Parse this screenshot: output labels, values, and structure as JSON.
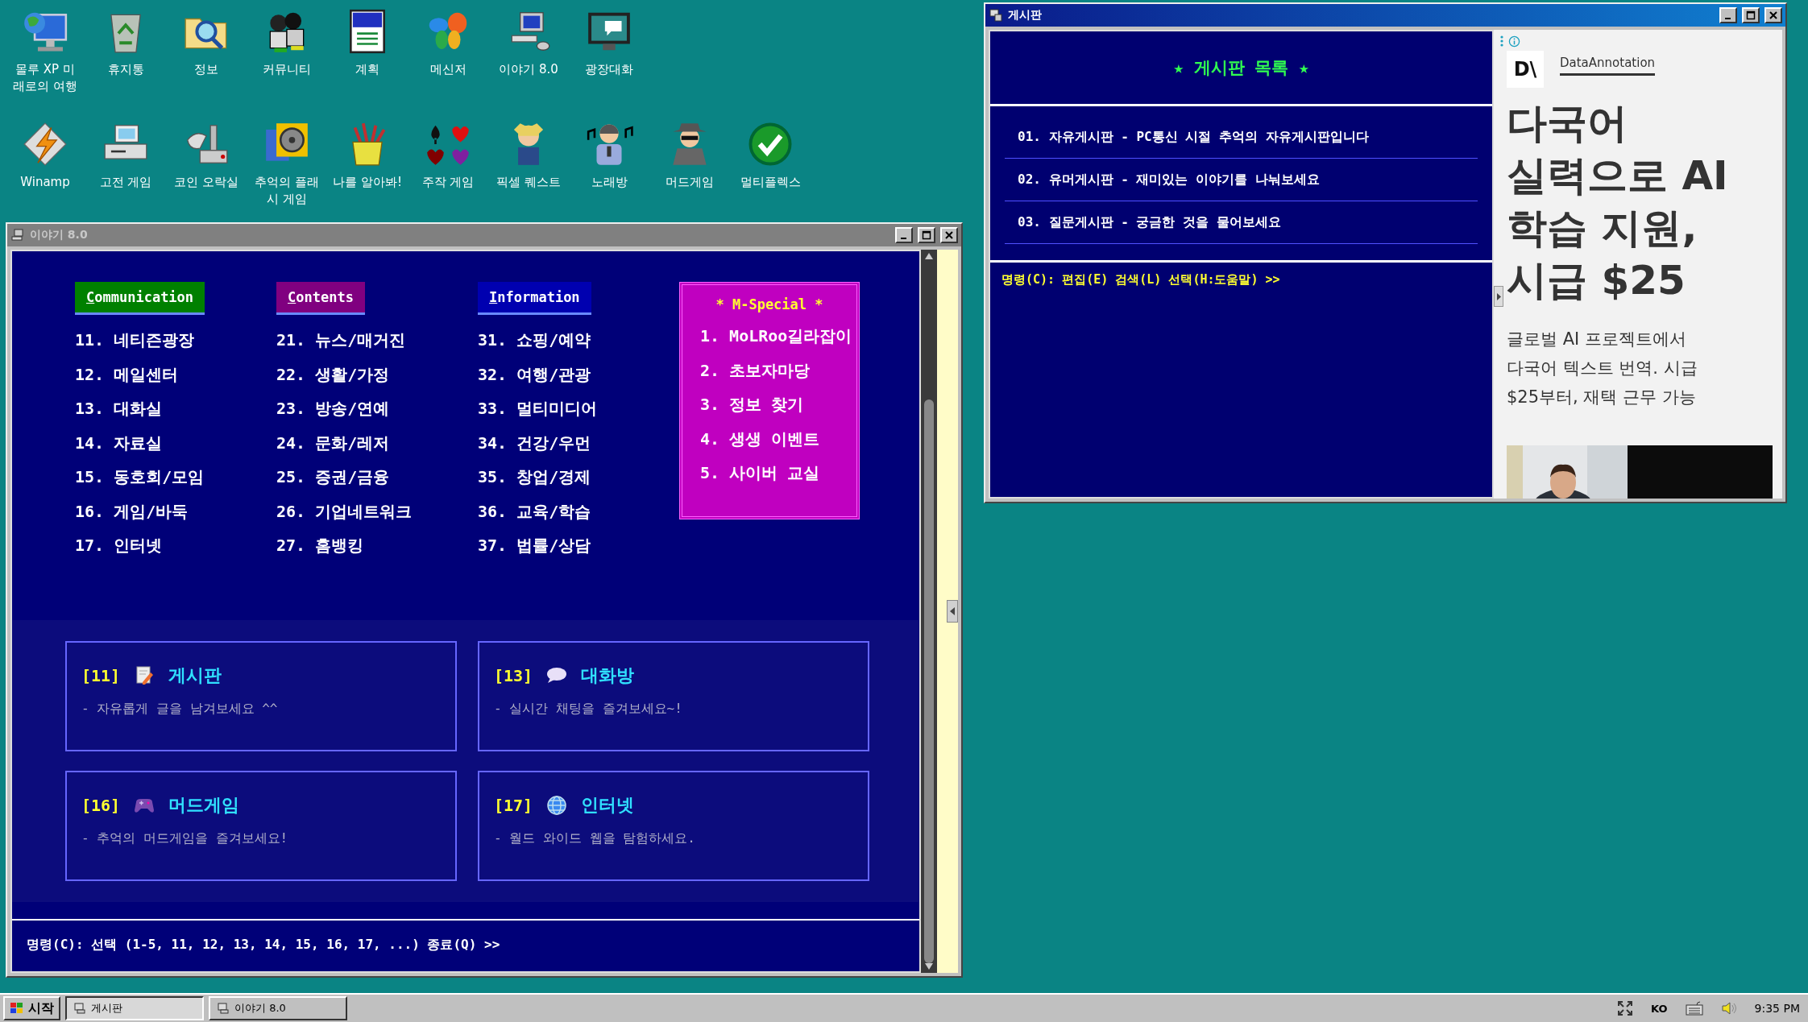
{
  "desktop_rows": [
    {
      "icons": [
        {
          "label": "몰루 XP 미래로의 여행"
        },
        {
          "label": "휴지통"
        },
        {
          "label": "정보"
        },
        {
          "label": "커뮤니티"
        },
        {
          "label": "계획"
        },
        {
          "label": "메신저"
        },
        {
          "label": "이야기 8.0"
        },
        {
          "label": "광장대화"
        }
      ]
    },
    {
      "icons": [
        {
          "label": "Winamp"
        },
        {
          "label": "고전 게임"
        },
        {
          "label": "코인 오락실"
        },
        {
          "label": "추억의 플래시 게임"
        },
        {
          "label": "나를 알아봐!"
        },
        {
          "label": "주작 게임"
        },
        {
          "label": "픽셀 퀘스트"
        },
        {
          "label": "노래방"
        },
        {
          "label": "머드게임"
        },
        {
          "label": "멀티플렉스"
        }
      ]
    }
  ],
  "main_window": {
    "title": "이야기 8.0",
    "active": false,
    "menu_columns": [
      {
        "heading": "Communication",
        "color": "#008000",
        "items": [
          "11. 네티즌광장",
          "12. 메일센터",
          "13. 대화실",
          "14. 자료실",
          "15. 동호회/모임",
          "16. 게임/바둑",
          "17. 인터넷"
        ]
      },
      {
        "heading": "Contents",
        "color": "#800080",
        "items": [
          "21. 뉴스/매거진",
          "22. 생활/가정",
          "23. 방송/연예",
          "24. 문화/레저",
          "25. 증권/금융",
          "26. 기업네트워크",
          "27. 홈뱅킹"
        ]
      },
      {
        "heading": "Information",
        "color": "#0000b0",
        "items": [
          "31. 쇼핑/예약",
          "32. 여행/관광",
          "33. 멀티미디어",
          "34. 건강/우먼",
          "35. 창업/경제",
          "36. 교육/학습",
          "37. 법률/상담"
        ]
      }
    ],
    "special": {
      "title": "* M-Special *",
      "items": [
        "1. MoLRoo길라잡이",
        "2. 초보자마당",
        "3. 정보 찾기",
        "4. 생생 이벤트",
        "5. 사이버 교실"
      ]
    },
    "cards": [
      {
        "code": "[11]",
        "title": "게시판",
        "desc": "- 자유롭게 글을 남겨보세요 ^^"
      },
      {
        "code": "[13]",
        "title": "대화방",
        "desc": "- 실시간 채팅을 즐겨보세요~!"
      },
      {
        "code": "[16]",
        "title": "머드게임",
        "desc": "- 추억의 머드게임을 즐겨보세요!"
      },
      {
        "code": "[17]",
        "title": "인터넷",
        "desc": "- 월드 와이드 웹을 탐험하세요."
      }
    ],
    "command": "명령(C): 선택 (1-5, 11, 12, 13, 14, 15, 16, 17, ...) 종료(Q) >>"
  },
  "board_window": {
    "title": "게시판",
    "active": true,
    "heading": "★ 게시판 목록 ★",
    "posts": [
      "01. 자유게시판 - PC통신 시절 추억의 자유게시판입니다",
      "02. 유머게시판 - 재미있는 이야기를 나눠보세요",
      "03. 질문게시판 - 궁금한 것을 물어보세요"
    ],
    "command": "명령(C): 편집(E) 검색(L) 선택(H:도움말) >>",
    "ad": {
      "logo": "D\\",
      "brand": "DataAnnotation",
      "headline": "다국어 실력으로 AI 학습 지원, 시급 $25",
      "body": "글로벌 AI 프로젝트에서 다국어 텍스트 번역. 시급 $25부터, 재택 근무 가능"
    }
  },
  "taskbar": {
    "start": "시작",
    "tasks": [
      {
        "label": "게시판",
        "selected": true
      },
      {
        "label": "이야기 8.0",
        "selected": false
      }
    ],
    "language": "KO",
    "time": "9:35 PM"
  }
}
